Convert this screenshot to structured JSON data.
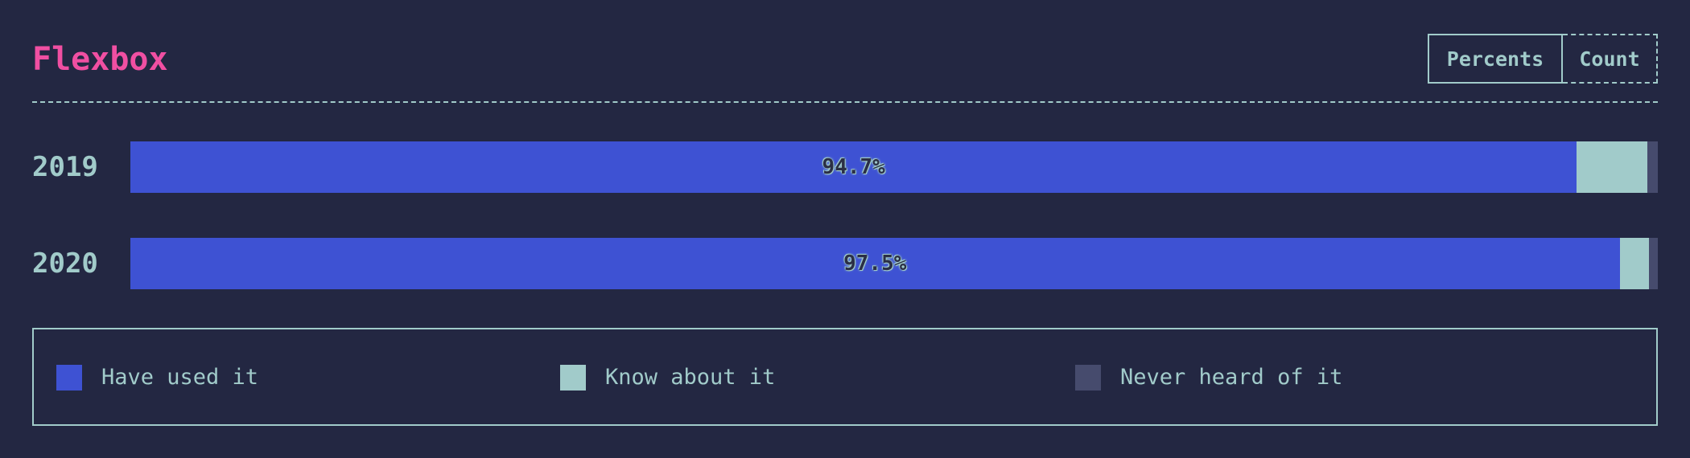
{
  "header": {
    "title": "Flexbox",
    "toggle": {
      "percents_label": "Percents",
      "count_label": "Count"
    }
  },
  "colors": {
    "background": "#232742",
    "title": "#f04fa2",
    "text": "#a1cbca",
    "used": "#3e52d3",
    "know": "#a1cbca",
    "never": "#464b6d"
  },
  "chart_data": {
    "type": "bar",
    "orientation": "horizontal",
    "stacked": true,
    "title": "Flexbox",
    "categories": [
      "2019",
      "2020"
    ],
    "series": [
      {
        "name": "Have used it",
        "values": [
          94.7,
          97.5
        ]
      },
      {
        "name": "Know about it",
        "values": [
          4.6,
          1.9
        ]
      },
      {
        "name": "Never heard of it",
        "values": [
          0.7,
          0.6
        ]
      }
    ],
    "data_labels": [
      "94.7%",
      "97.5%"
    ],
    "xlim": [
      0,
      100
    ],
    "legend_position": "bottom"
  },
  "legend": {
    "items": [
      {
        "label": "Have used it"
      },
      {
        "label": "Know about it"
      },
      {
        "label": "Never heard of it"
      }
    ]
  }
}
